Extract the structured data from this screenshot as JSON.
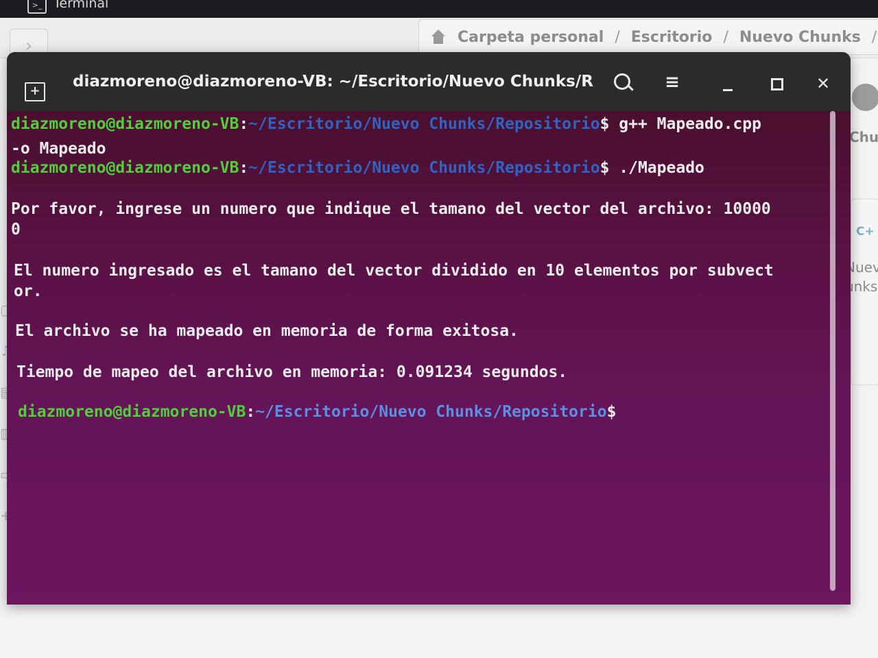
{
  "shell": {
    "title": "Terminal",
    "icon": "terminal-icon"
  },
  "files": {
    "back_icon": "chevron-right-icon",
    "breadcrumb": [
      "Carpeta personal",
      "Escritorio",
      "Nuevo Chunks"
    ],
    "separator": "/",
    "right_items": [
      "Chun",
      "C+",
      "Nuev",
      "unks"
    ]
  },
  "window": {
    "title": "diazmoreno@diazmoreno-VB: ~/Escritorio/Nuevo Chunks/Re...",
    "menu_glyph": "≡",
    "close_glyph": "✕",
    "new_tab_glyph": "+"
  },
  "terminal": {
    "prompt_user": "diazmoreno@diazmoreno-VB",
    "prompt_colon": ":",
    "prompt_path": "~/Escritorio/Nuevo Chunks/Repositorio",
    "prompt_dollar": "$",
    "cmd1_part1": " g++ Mapeado.cpp",
    "cmd1_part2": "-o Mapeado",
    "cmd2": " ./Mapeado",
    "out1a": "Por favor, ingrese un numero que indique el tamano del vector del archivo: 10000",
    "out1b": "0",
    "out2a": "El numero ingresado es el tamano del vector dividido en 10 elementos por subvect",
    "out2b": "or.",
    "out3": "El archivo se ha mapeado en memoria de forma exitosa.",
    "out4": "Tiempo de mapeo del archivo en memoria: 0.091234 segundos."
  },
  "colors": {
    "user_green": "#4fcf3a",
    "path_blue": "#2f63c4",
    "terminal_bg": "#5a1245"
  }
}
